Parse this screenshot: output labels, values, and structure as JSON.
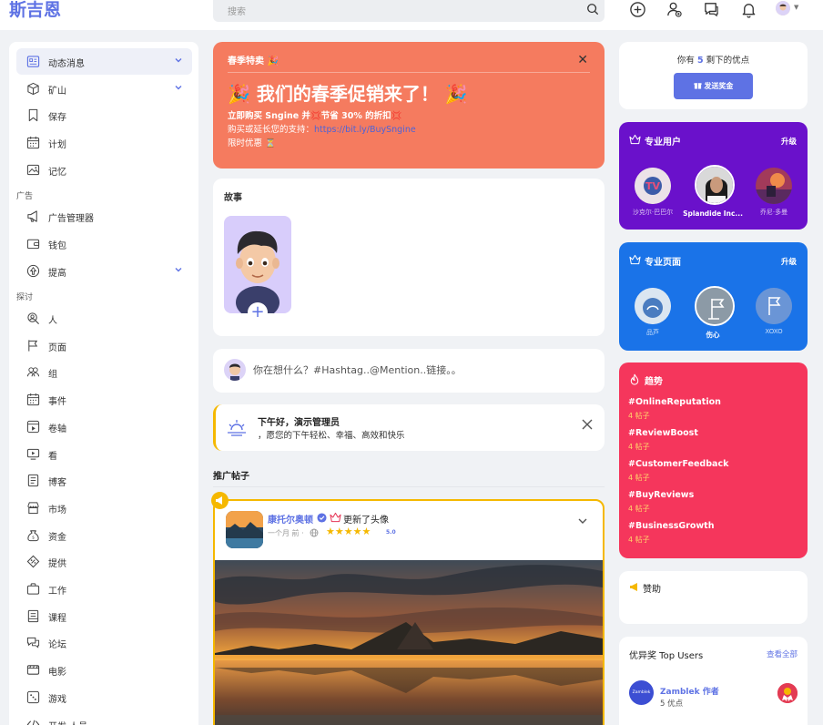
{
  "header": {
    "logo": "斯吉恩",
    "search_placeholder": "搜索"
  },
  "sidebar": {
    "items": [
      {
        "label": "动态消息",
        "icon": "newsfeed-icon",
        "active": true,
        "chevron": true
      },
      {
        "label": "矿山",
        "icon": "cube-icon",
        "chevron": true
      },
      {
        "label": "保存",
        "icon": "bookmark-icon"
      },
      {
        "label": "计划",
        "icon": "calendar-icon"
      },
      {
        "label": "记忆",
        "icon": "memories-icon"
      }
    ],
    "section_ads": "广告",
    "ads_items": [
      {
        "label": "广告管理器",
        "icon": "megaphone-icon"
      },
      {
        "label": "钱包",
        "icon": "wallet-icon"
      },
      {
        "label": "提高",
        "icon": "boost-icon",
        "chevron": true
      }
    ],
    "section_explore": "探讨",
    "explore_items": [
      {
        "label": "人",
        "icon": "people-search-icon"
      },
      {
        "label": "页面",
        "icon": "flag-icon"
      },
      {
        "label": "组",
        "icon": "groups-icon"
      },
      {
        "label": "事件",
        "icon": "calendar-event-icon"
      },
      {
        "label": "卷轴",
        "icon": "reels-icon"
      },
      {
        "label": "看",
        "icon": "watch-icon"
      },
      {
        "label": "博客",
        "icon": "blog-icon"
      },
      {
        "label": "市场",
        "icon": "market-icon"
      },
      {
        "label": "资金",
        "icon": "money-bag-icon"
      },
      {
        "label": "提供",
        "icon": "offers-icon"
      },
      {
        "label": "工作",
        "icon": "briefcase-icon"
      },
      {
        "label": "课程",
        "icon": "courses-icon"
      },
      {
        "label": "论坛",
        "icon": "forum-icon"
      },
      {
        "label": "电影",
        "icon": "movie-icon"
      },
      {
        "label": "游戏",
        "icon": "game-icon"
      },
      {
        "label": "开发 人员",
        "icon": "developers-icon"
      }
    ]
  },
  "promo": {
    "tag": "春季特卖 🎉",
    "title": "🎉 我们的春季促销来了！ 🎉",
    "line1": "立即购买 Sngine 并💢节省 30% 的折扣💢",
    "line2_prefix": "购买或延长您的支持：",
    "line2_link": "https://bit.ly/BuySngine",
    "line3": "限时优惠 ⏳"
  },
  "stories": {
    "title": "故事"
  },
  "composer": {
    "placeholder": "你在想什么？#Hashtag..@Mention..链接。。"
  },
  "greeting": {
    "title": "下午好，演示管理员",
    "subtitle": "，愿您的下午轻松、幸福、高效和快乐"
  },
  "promoted": {
    "heading": "推广帖子",
    "author": "康托尔奥顿",
    "action": "更新了头像",
    "time": "一个月 前 ·",
    "rating": "5.0",
    "stars": "★★★★★"
  },
  "points": {
    "prefix": "你有",
    "count": "5",
    "suffix": "剩下的优点",
    "button": "发送奖金"
  },
  "pro_users": {
    "title": "专业用户",
    "upgrade": "升级",
    "users": [
      {
        "name": "沙克尔·巴巴尔"
      },
      {
        "name": "Splandide Inc..."
      },
      {
        "name": "乔尼·多曼"
      }
    ]
  },
  "pro_pages": {
    "title": "专业页面",
    "upgrade": "升级",
    "pages": [
      {
        "name": "品芦"
      },
      {
        "name": "伤心"
      },
      {
        "name": "XOXO"
      }
    ]
  },
  "trending": {
    "title": "趋势",
    "items": [
      {
        "tag": "#OnlineReputation",
        "count": "4 帖子"
      },
      {
        "tag": "#ReviewBoost",
        "count": "4 帖子"
      },
      {
        "tag": "#CustomerFeedback",
        "count": "4 帖子"
      },
      {
        "tag": "#BuyReviews",
        "count": "4 帖子"
      },
      {
        "tag": "#BusinessGrowth",
        "count": "4 帖子"
      }
    ]
  },
  "sponsored": {
    "label": "赞助"
  },
  "top_users": {
    "title": "优异奖 Top Users",
    "see_all": "查看全部",
    "user": {
      "avatar_text": "Zamblek",
      "name": "Zamblek 作者",
      "points": "5 优点"
    }
  },
  "colors": {
    "accent": "#5e72e4",
    "promo": "#f57b5f",
    "pro_users": "#6a11cb",
    "pro_pages": "#1a73e8",
    "trending": "#f5365c",
    "featured_border": "#f5b800"
  }
}
